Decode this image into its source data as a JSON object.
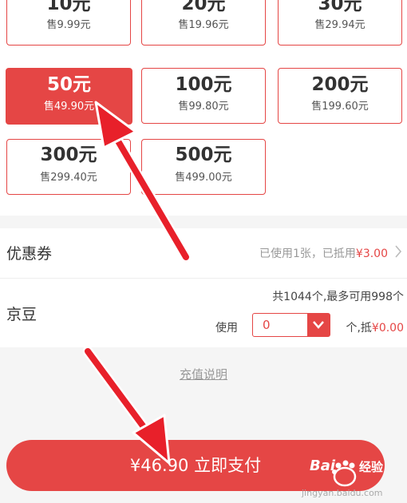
{
  "amounts": [
    {
      "amount": "10元",
      "price": "售9.99元",
      "selected": false
    },
    {
      "amount": "20元",
      "price": "售19.96元",
      "selected": false
    },
    {
      "amount": "30元",
      "price": "售29.94元",
      "selected": false
    },
    {
      "amount": "50元",
      "price": "售49.90元",
      "selected": true
    },
    {
      "amount": "100元",
      "price": "售99.80元",
      "selected": false
    },
    {
      "amount": "200元",
      "price": "售199.60元",
      "selected": false
    },
    {
      "amount": "300元",
      "price": "售299.40元",
      "selected": false
    },
    {
      "amount": "500元",
      "price": "售499.00元",
      "selected": false
    }
  ],
  "coupon": {
    "label": "优惠券",
    "detail": "已使用1张，已抵用",
    "discount": "¥3.00"
  },
  "beans": {
    "label": "京豆",
    "total": "共1044个,最多可用998个",
    "use_label": "使用",
    "use_value": "0",
    "offset_label": "个,抵",
    "offset_value": "¥0.00"
  },
  "help_link": "充值说明",
  "pay_button": "¥46.90 立即支付",
  "watermark": {
    "brand": "Bai",
    "label": "经验",
    "url": "jingyan.baidu.com"
  },
  "colors": {
    "accent": "#e54645",
    "annotation_arrow": "#e8202a"
  }
}
